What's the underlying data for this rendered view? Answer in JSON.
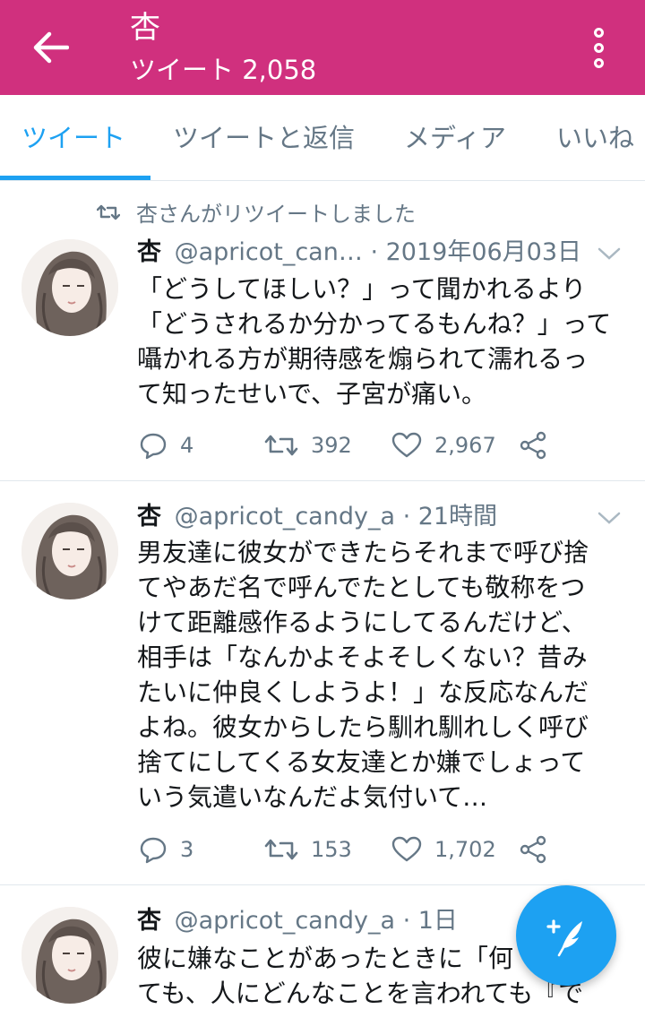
{
  "header": {
    "title": "杏",
    "subtitle": "ツイート 2,058"
  },
  "tabs": [
    {
      "label": "ツイート",
      "active": true
    },
    {
      "label": "ツイートと返信",
      "active": false
    },
    {
      "label": "メディア",
      "active": false
    },
    {
      "label": "いいね",
      "active": false
    }
  ],
  "tweets": [
    {
      "retweet_label": "杏さんがリツイートしました",
      "name": "杏",
      "handle": "@apricot_can…",
      "time": "· 2019年06月03日",
      "text": "「どうしてほしい？」って聞かれるより\n「どうされるか分かってるもんね？」って\n囁かれる方が期待感を煽られて濡れるっ\nて知ったせいで、子宮が痛い。",
      "replies": "4",
      "retweets": "392",
      "likes": "2,967"
    },
    {
      "name": "杏",
      "handle": "@apricot_candy_a",
      "time": "· 21時間",
      "text": "男友達に彼女ができたらそれまで呼び捨\nてやあだ名で呼んでたとしても敬称をつ\nけて距離感作るようにしてるんだけど、\n相手は「なんかよそよそしくない？昔み\nたいに仲良くしようよ！」な反応なんだ\nよね。彼女からしたら馴れ馴れしく呼び\n捨てにしてくる女友達とか嫌でしょって\nいう気遣いなんだよ気付いて…",
      "replies": "3",
      "retweets": "153",
      "likes": "1,702"
    },
    {
      "name": "杏",
      "handle": "@apricot_candy_a",
      "time": "· 1日",
      "text": "彼に嫌なことがあったときに「何\nても、人にどんなことを言われても『で"
    }
  ],
  "colors": {
    "appbar": "#d0307e",
    "accent": "#1da1f2",
    "secondary_text": "#657786"
  },
  "icons": {
    "back": "arrow-left-icon",
    "more": "more-vertical-icon",
    "reply": "reply-icon",
    "retweet": "retweet-icon",
    "like": "heart-icon",
    "share": "share-icon",
    "compose": "compose-tweet-icon"
  }
}
